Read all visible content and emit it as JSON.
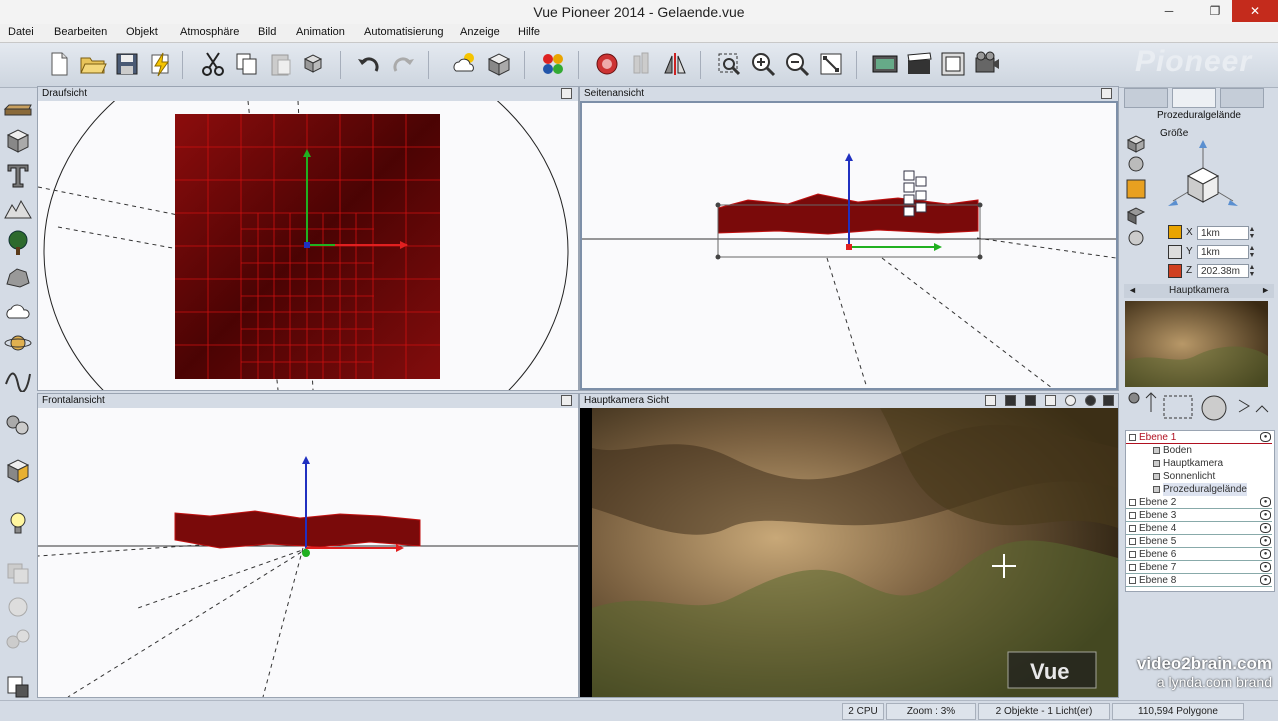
{
  "window": {
    "title": "Vue Pioneer 2014 - Gelaende.vue",
    "minimize": "─",
    "maximize": "❐",
    "close": "✕"
  },
  "menu": [
    "Datei",
    "Bearbeiten",
    "Objekt",
    "Atmosphäre",
    "Bild",
    "Animation",
    "Automatisierung",
    "Anzeige",
    "Hilfe"
  ],
  "toolbar": {
    "watermark": "Pioneer"
  },
  "viewports": {
    "top": {
      "label": "Draufsicht"
    },
    "side": {
      "label": "Seitenansicht"
    },
    "front": {
      "label": "Frontalansicht"
    },
    "camera": {
      "label": "Hauptkamera Sicht"
    }
  },
  "right_panel": {
    "section_title": "Prozeduralgelände",
    "size_label": "Größe",
    "x_label": "X",
    "x_value": "1km",
    "y_label": "Y",
    "y_value": "1km",
    "z_label": "Z",
    "z_value": "202.38m",
    "camera_title": "Hauptkamera",
    "camera_prev": "◄",
    "camera_next": "►"
  },
  "tree": {
    "items": [
      {
        "label": "Ebene 1",
        "indent": 0,
        "selected": true
      },
      {
        "label": "Boden",
        "indent": 2
      },
      {
        "label": "Hauptkamera",
        "indent": 2
      },
      {
        "label": "Sonnenlicht",
        "indent": 2
      },
      {
        "label": "Prozeduralgelände",
        "indent": 2,
        "highlight": true
      },
      {
        "label": "Ebene 2",
        "indent": 0
      },
      {
        "label": "Ebene 3",
        "indent": 0
      },
      {
        "label": "Ebene 4",
        "indent": 0
      },
      {
        "label": "Ebene 5",
        "indent": 0
      },
      {
        "label": "Ebene 6",
        "indent": 0
      },
      {
        "label": "Ebene 7",
        "indent": 0
      },
      {
        "label": "Ebene 8",
        "indent": 0
      }
    ]
  },
  "status": {
    "cpu": "2 CPU",
    "zoom": "Zoom : 3%",
    "objects": "2 Objekte - 1 Licht(er)",
    "polygons": "110,594 Polygone"
  },
  "brand": {
    "line1": "video2brain.com",
    "line2": "a lynda.com brand",
    "vue_logo": "Vue"
  },
  "colors": {
    "terrain": "#7a0a0a",
    "grid": "#d01010",
    "axis_x": "#e02020",
    "axis_y": "#20b020",
    "axis_z": "#2030c0",
    "panel_bg": "#d4dbe5"
  }
}
